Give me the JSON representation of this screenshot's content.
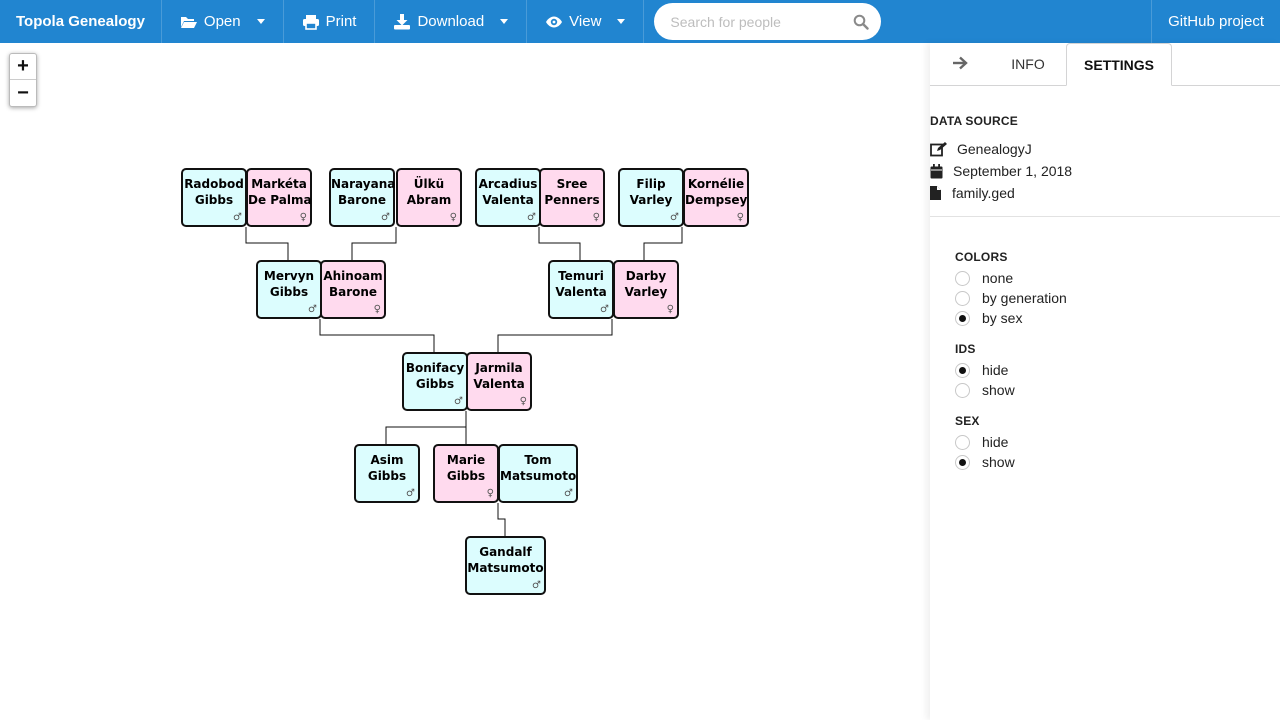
{
  "topbar": {
    "brand": "Topola Genealogy",
    "menus": [
      {
        "label": "Open",
        "icon": "folder-open-icon",
        "dropdown": true
      },
      {
        "label": "Print",
        "icon": "print-icon",
        "dropdown": false
      },
      {
        "label": "Download",
        "icon": "download-icon",
        "dropdown": true
      },
      {
        "label": "View",
        "icon": "eye-icon",
        "dropdown": true
      }
    ],
    "search_placeholder": "Search for people",
    "github": "GitHub project"
  },
  "zoom": {
    "in": "+",
    "out": "−"
  },
  "tree": {
    "people": [
      {
        "id": "radobod",
        "line1": "Radobod",
        "line2": "Gibbs",
        "sex": "m"
      },
      {
        "id": "marketa",
        "line1": "Markéta",
        "line2": "De Palma",
        "sex": "f"
      },
      {
        "id": "narayana",
        "line1": "Narayana",
        "line2": "Barone",
        "sex": "m"
      },
      {
        "id": "ulku",
        "line1": "Ülkü",
        "line2": "Abram",
        "sex": "f"
      },
      {
        "id": "arcadius",
        "line1": "Arcadius",
        "line2": "Valenta",
        "sex": "m"
      },
      {
        "id": "sree",
        "line1": "Sree",
        "line2": "Penners",
        "sex": "f"
      },
      {
        "id": "filip",
        "line1": "Filip",
        "line2": "Varley",
        "sex": "m"
      },
      {
        "id": "kornelie",
        "line1": "Kornélie",
        "line2": "Dempsey",
        "sex": "f"
      },
      {
        "id": "mervyn",
        "line1": "Mervyn",
        "line2": "Gibbs",
        "sex": "m"
      },
      {
        "id": "ahinoam",
        "line1": "Ahinoam",
        "line2": "Barone",
        "sex": "f"
      },
      {
        "id": "temuri",
        "line1": "Temuri",
        "line2": "Valenta",
        "sex": "m"
      },
      {
        "id": "darby",
        "line1": "Darby",
        "line2": "Varley",
        "sex": "f"
      },
      {
        "id": "bonifacy",
        "line1": "Bonifacy",
        "line2": "Gibbs",
        "sex": "m"
      },
      {
        "id": "jarmila",
        "line1": "Jarmila",
        "line2": "Valenta",
        "sex": "f"
      },
      {
        "id": "asim",
        "line1": "Asim",
        "line2": "Gibbs",
        "sex": "m"
      },
      {
        "id": "marie",
        "line1": "Marie",
        "line2": "Gibbs",
        "sex": "f"
      },
      {
        "id": "tom",
        "line1": "Tom",
        "line2": "Matsumoto",
        "sex": "m"
      },
      {
        "id": "gandalf",
        "line1": "Gandalf",
        "line2": "Matsumoto",
        "sex": "m"
      }
    ],
    "sex_symbols": {
      "m": "♂",
      "f": "♀"
    },
    "colors": {
      "male": "#dcfdfe",
      "female": "#ffdaee",
      "border": "#111111"
    }
  },
  "panel": {
    "tabs": {
      "arrow": "→",
      "info": "INFO",
      "settings": "SETTINGS"
    },
    "data_source": {
      "title": "DATA SOURCE",
      "source": "GenealogyJ",
      "date": "September 1, 2018",
      "file": "family.ged"
    },
    "colors": {
      "title": "COLORS",
      "options": [
        "none",
        "by generation",
        "by sex"
      ],
      "selected": 2
    },
    "ids": {
      "title": "IDS",
      "options": [
        "hide",
        "show"
      ],
      "selected": 0
    },
    "sex": {
      "title": "SEX",
      "options": [
        "hide",
        "show"
      ],
      "selected": 1
    }
  },
  "theme": {
    "accent": "#2185d0"
  }
}
